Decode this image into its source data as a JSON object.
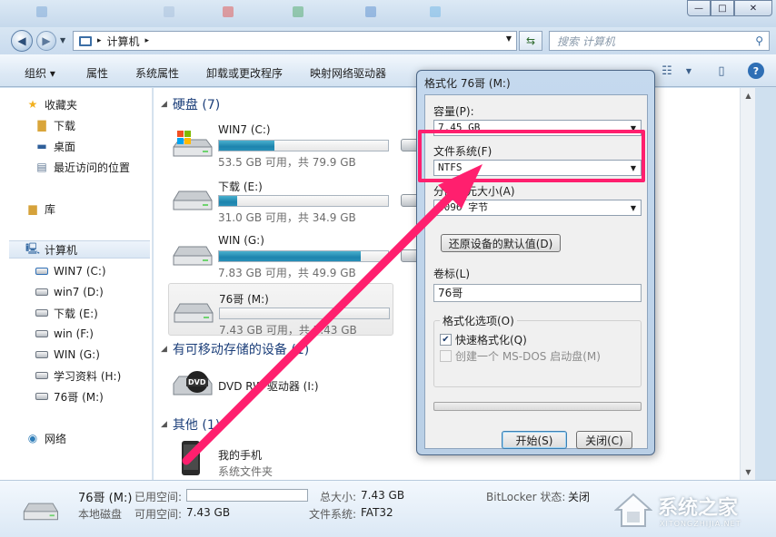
{
  "window": {
    "controls": {
      "minimize": "—",
      "maximize": "□",
      "close": "✕"
    }
  },
  "address": {
    "path_parts": [
      "计算机"
    ],
    "search_placeholder": "搜索 计算机"
  },
  "toolbar": {
    "items": [
      "组织 ▾",
      "属性",
      "系统属性",
      "卸载或更改程序",
      "映射网络驱动器"
    ]
  },
  "sidebar": {
    "favorites_label": "收藏夹",
    "favorites": [
      "下载",
      "桌面",
      "最近访问的位置"
    ],
    "library_label": "库",
    "computer_label": "计算机",
    "drives": [
      "WIN7 (C:)",
      "win7 (D:)",
      "下载 (E:)",
      "win (F:)",
      "WIN (G:)",
      "学习资料 (H:)",
      "76哥 (M:)"
    ],
    "network_label": "网络"
  },
  "main": {
    "hard_disks_header": "硬盘 (7)",
    "drives": [
      {
        "name": "WIN7 (C:)",
        "size_text": "53.5 GB 可用，共 79.9 GB",
        "used_fraction": 0.33
      },
      {
        "name": "下载 (E:)",
        "size_text": "31.0 GB 可用，共 34.9 GB",
        "used_fraction": 0.11
      },
      {
        "name": "WIN (G:)",
        "size_text": "7.83 GB 可用，共 49.9 GB",
        "used_fraction": 0.84
      },
      {
        "name": "76哥 (M:)",
        "size_text": "7.43 GB 可用，共 7.43 GB",
        "used_fraction": 0.0
      }
    ],
    "removable_header": "有可移动存储的设备 (1)",
    "dvd_name": "DVD RW 驱动器 (I:)",
    "dvd_badge": "DVD",
    "other_header": "其他 (1)",
    "phone_name": "我的手机",
    "phone_type": "系统文件夹"
  },
  "details": {
    "name": "76哥 (M:)",
    "type": "本地磁盘",
    "used_label": "已用空间:",
    "free_label": "可用空间:",
    "free_value": "7.43 GB",
    "total_label": "总大小:",
    "total_value": "7.43 GB",
    "fs_label": "文件系统:",
    "fs_value": "FAT32",
    "bitlocker_label": "BitLocker 状态:",
    "bitlocker_value": "关闭"
  },
  "dialog": {
    "title": "格式化 76哥 (M:)",
    "capacity_label": "容量(P):",
    "capacity_value": "7.45 GB",
    "fs_label": "文件系统(F)",
    "fs_value": "NTFS",
    "alloc_label": "分配单元大小(A)",
    "alloc_value": "4096 字节",
    "restore_button": "还原设备的默认值(D)",
    "volume_label": "卷标(L)",
    "volume_value": "76哥",
    "options_label": "格式化选项(O)",
    "quick_format": "快速格式化(Q)",
    "msdos_disk": "创建一个 MS-DOS 启动盘(M)",
    "start_button": "开始(S)",
    "close_button": "关闭(C)"
  },
  "watermark": {
    "text": "系统之家",
    "subtext": "XITONGZHIJIA.NET"
  },
  "colors": {
    "accent": "#ff1f6e",
    "bar_fill": "#1d84ae",
    "window_chrome": "#c9dbee"
  }
}
